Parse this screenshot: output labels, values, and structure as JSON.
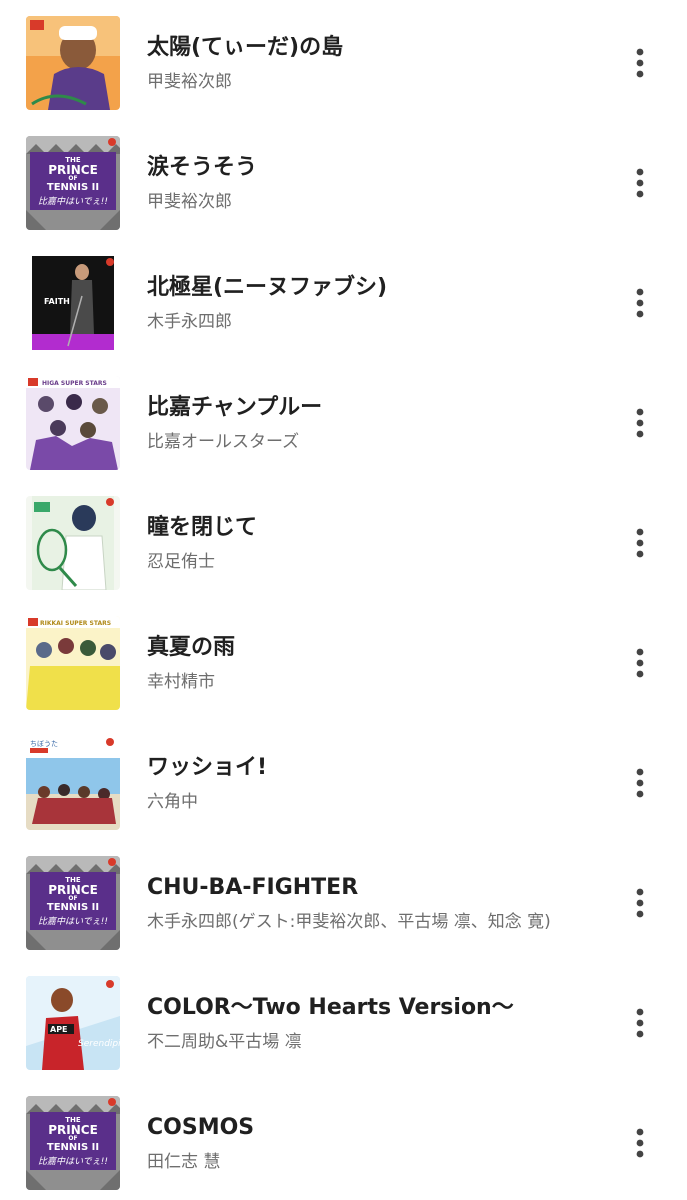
{
  "tracks": [
    {
      "title": "太陽(てぃーだ)の島",
      "artist": "甲斐裕次郎",
      "art": "purple-portrait"
    },
    {
      "title": "涙そうそう",
      "artist": "甲斐裕次郎",
      "art": "prince-of-tennis-ii"
    },
    {
      "title": "北極星(ニーヌファブシ)",
      "artist": "木手永四郎",
      "art": "faith-black"
    },
    {
      "title": "比嘉チャンプルー",
      "artist": "比嘉オールスターズ",
      "art": "higa-super-stars"
    },
    {
      "title": "瞳を閉じて",
      "artist": "忍足侑士",
      "art": "green-racket"
    },
    {
      "title": "真夏の雨",
      "artist": "幸村精市",
      "art": "rikkai-super-stars"
    },
    {
      "title": "ワッショイ!",
      "artist": "六角中",
      "art": "beach-group"
    },
    {
      "title": "CHU-BA-FIGHTER",
      "artist": "木手永四郎(ゲスト:甲斐裕次郎、平古場 凛、知念 寛)",
      "art": "prince-of-tennis-ii"
    },
    {
      "title": "COLOR〜Two Hearts Version〜",
      "artist": "不二周助&平古場 凛",
      "art": "serendipity-blue"
    },
    {
      "title": "COSMOS",
      "artist": "田仁志 慧",
      "art": "prince-of-tennis-ii"
    }
  ],
  "album_art_text": {
    "prince_line1": "THE",
    "prince_line2": "PRINCE",
    "prince_line3": "OF",
    "prince_line4": "TENNIS II",
    "prince_sub": "比嘉中はいでぇ!!",
    "faith": "FAITH",
    "higa": "HIGA SUPER STARS",
    "rikkai": "RIKKAI SUPER STARS",
    "chibiuta": "ちぼうた",
    "serendipity": "Serendipity",
    "color_ape": "APE"
  },
  "icons": {
    "more": "more-vert-icon"
  },
  "colors": {
    "title": "#202020",
    "artist": "#6e6e6e",
    "menu": "#444444"
  }
}
